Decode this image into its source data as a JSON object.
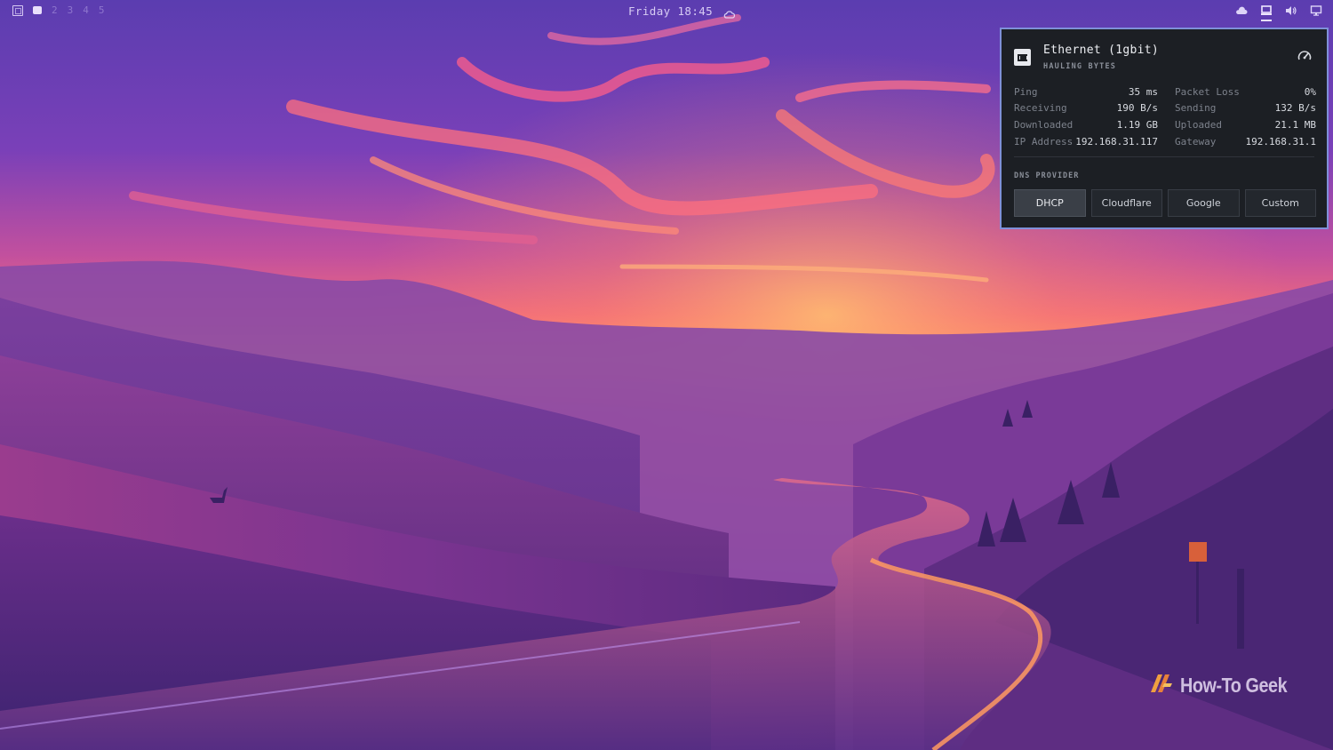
{
  "topbar": {
    "workspaces": [
      "2",
      "3",
      "4",
      "5"
    ],
    "clock": "Friday 18:45",
    "tray_icons": [
      "cloud-weather-icon",
      "laptop-network-icon",
      "volume-icon",
      "monitor-icon"
    ]
  },
  "network_panel": {
    "title": "Ethernet (1gbit)",
    "subtitle": "HAULING BYTES",
    "stats": [
      [
        {
          "label": "Ping",
          "value": "35 ms"
        },
        {
          "label": "Packet Loss",
          "value": "0%"
        }
      ],
      [
        {
          "label": "Receiving",
          "value": "190 B/s"
        },
        {
          "label": "Sending",
          "value": "132 B/s"
        }
      ],
      [
        {
          "label": "Downloaded",
          "value": "1.19 GB"
        },
        {
          "label": "Uploaded",
          "value": "21.1 MB"
        }
      ],
      [
        {
          "label": "IP Address",
          "value": "192.168.31.117"
        },
        {
          "label": "Gateway",
          "value": "192.168.31.1"
        }
      ]
    ],
    "dns_label": "DNS PROVIDER",
    "dns_options": [
      "DHCP",
      "Cloudflare",
      "Google",
      "Custom"
    ],
    "dns_selected": "DHCP"
  },
  "watermark": {
    "text": "How-To Geek"
  },
  "colors": {
    "panel_bg": "#1c1f24",
    "panel_border": "#7f90d8",
    "sky_top": "#5a3aa8",
    "sky_glow": "#ff8a5c"
  }
}
